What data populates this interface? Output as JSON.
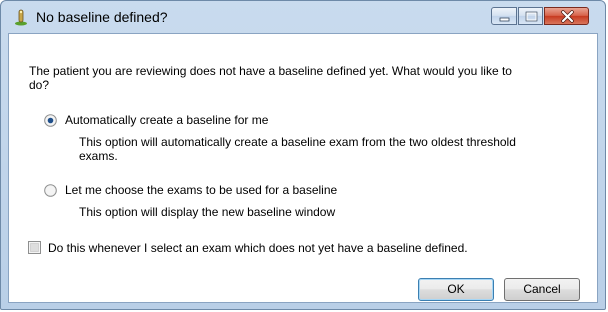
{
  "window": {
    "title": "No baseline defined?",
    "controls": {
      "minimize": "minimize-icon",
      "maximize": "maximize-icon",
      "close": "close-icon"
    }
  },
  "dialog": {
    "question": "The patient you are reviewing does not have a baseline defined yet. What would you like to do?",
    "options": [
      {
        "label": "Automatically create a baseline for me",
        "description": "This option will automatically create a baseline exam from the two oldest threshold exams.",
        "selected": true
      },
      {
        "label": "Let me choose the exams to be used for a baseline",
        "description": "This option will display the new baseline window",
        "selected": false
      }
    ],
    "checkbox": {
      "label": "Do this whenever I select an exam which does not yet have a baseline defined.",
      "checked": false
    },
    "buttons": {
      "ok": "OK",
      "cancel": "Cancel"
    }
  },
  "colors": {
    "title_bar": "#c9dbee",
    "close_button": "#c7391f",
    "default_button_border": "#3c7fb1"
  }
}
